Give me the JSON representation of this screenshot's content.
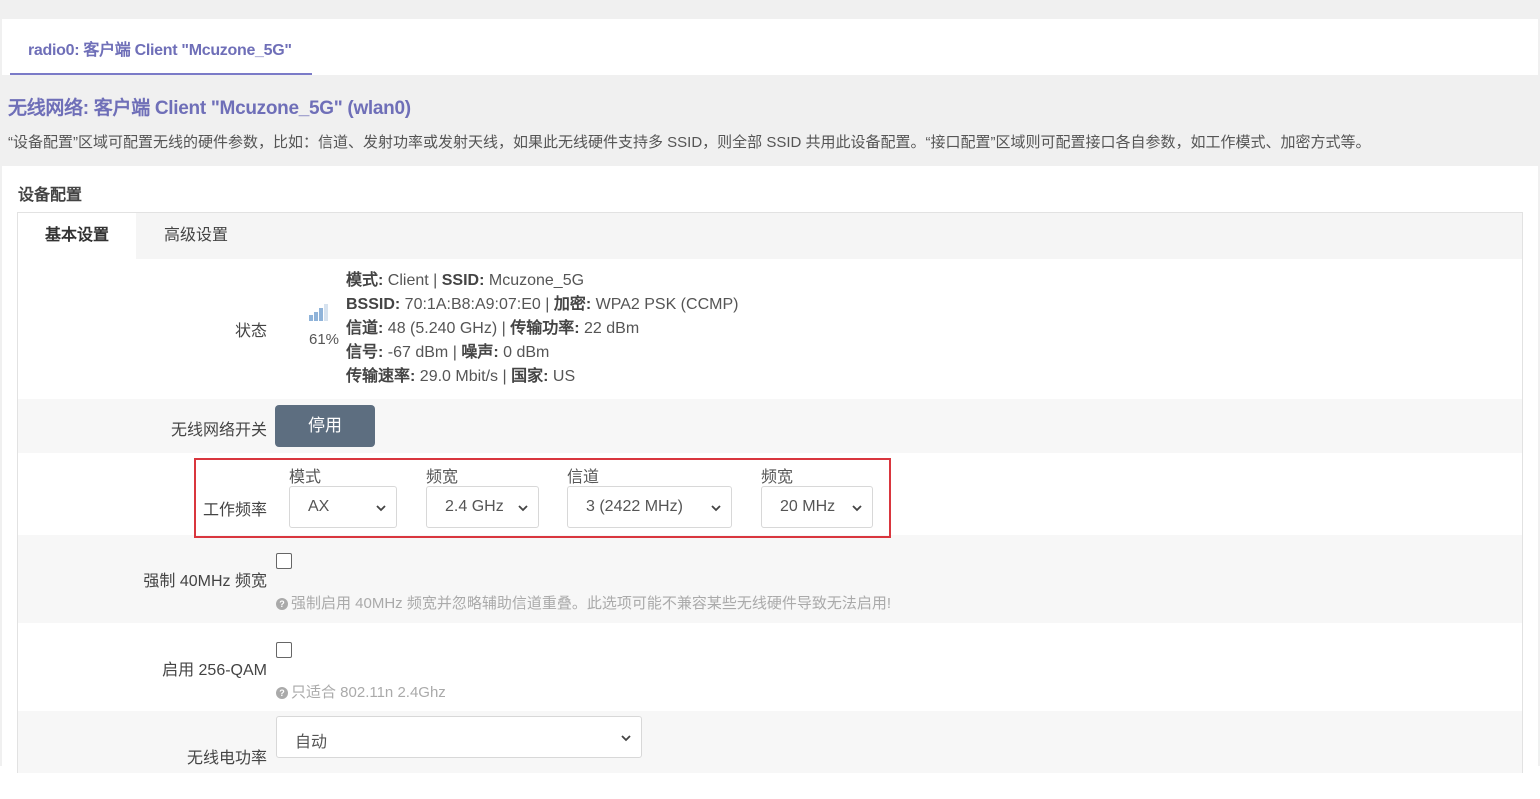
{
  "tabs": [
    {
      "label": "radio0: 客户端 Client \"Mcuzone_5G\""
    }
  ],
  "page": {
    "title": "无线网络: 客户端 Client \"Mcuzone_5G\" (wlan0)",
    "description": "“设备配置”区域可配置无线的硬件参数，比如：信道、发射功率或发射天线，如果此无线硬件支持多 SSID，则全部 SSID 共用此设备配置。“接口配置”区域则可配置接口各自参数，如工作模式、加密方式等。"
  },
  "device_config": {
    "section_title": "设备配置",
    "subtabs": [
      {
        "label": "基本设置"
      },
      {
        "label": "高级设置"
      }
    ]
  },
  "status": {
    "label": "状态",
    "signal_percent": "61%",
    "signal_level": 0.61,
    "lines": [
      [
        {
          "k": "模式:",
          "v": " Client | "
        },
        {
          "k": "SSID:",
          "v": " Mcuzone_5G"
        }
      ],
      [
        {
          "k": "BSSID:",
          "v": " 70:1A:B8:A9:07:E0 | "
        },
        {
          "k": "加密:",
          "v": " WPA2 PSK (CCMP)"
        }
      ],
      [
        {
          "k": "信道:",
          "v": " 48 (5.240 GHz) | "
        },
        {
          "k": "传输功率:",
          "v": " 22 dBm"
        }
      ],
      [
        {
          "k": "信号:",
          "v": " -67 dBm | "
        },
        {
          "k": "噪声:",
          "v": " 0 dBm"
        }
      ],
      [
        {
          "k": "传输速率:",
          "v": " 29.0 Mbit/s | "
        },
        {
          "k": "国家:",
          "v": " US"
        }
      ]
    ]
  },
  "wireless_switch": {
    "label": "无线网络开关",
    "button": "停用"
  },
  "frequency": {
    "label": "工作频率",
    "mode": {
      "label": "模式",
      "value": "AX"
    },
    "band": {
      "label": "频宽",
      "value": "2.4 GHz"
    },
    "channel": {
      "label": "信道",
      "value": "3 (2422 MHz)"
    },
    "width": {
      "label": "频宽",
      "value": "20 MHz"
    }
  },
  "force40": {
    "label": "强制 40MHz 频宽",
    "checked": false,
    "hint": "强制启用 40MHz 频宽并忽略辅助信道重叠。此选项可能不兼容某些无线硬件导致无法启用!"
  },
  "qam256": {
    "label": "启用 256-QAM",
    "checked": false,
    "hint": "只适合 802.11n 2.4Ghz"
  },
  "txpower": {
    "label": "无线电功率",
    "value": "自动"
  },
  "colors": {
    "accent": "#6f6fb8",
    "button": "#5d6e80",
    "highlight": "#d9363e"
  }
}
